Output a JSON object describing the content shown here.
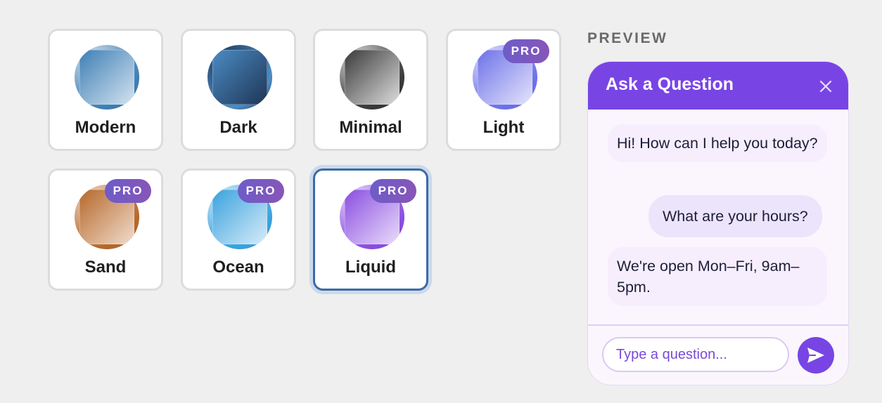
{
  "themes": [
    {
      "key": "modern",
      "label": "Modern",
      "pro": false,
      "selected": false,
      "colors": [
        "#3f7fb5",
        "#d3e3ef",
        "#2f6a9c"
      ]
    },
    {
      "key": "dark",
      "label": "Dark",
      "pro": false,
      "selected": false,
      "colors": [
        "#4b8cc4",
        "#1f3555",
        "#1a2a44"
      ]
    },
    {
      "key": "minimal",
      "label": "Minimal",
      "pro": false,
      "selected": false,
      "colors": [
        "#3a3a3a",
        "#dddddd",
        "#2a2a2a"
      ]
    },
    {
      "key": "light",
      "label": "Light",
      "pro": true,
      "selected": false,
      "colors": [
        "#6c72e8",
        "#e6e4fb",
        "#6a66df"
      ]
    },
    {
      "key": "sand",
      "label": "Sand",
      "pro": true,
      "selected": false,
      "colors": [
        "#b6682a",
        "#f0dccd",
        "#a25e2a"
      ]
    },
    {
      "key": "ocean",
      "label": "Ocean",
      "pro": true,
      "selected": false,
      "colors": [
        "#3aa2de",
        "#d8ecf8",
        "#3a8fd0"
      ]
    },
    {
      "key": "liquid",
      "label": "Liquid",
      "pro": true,
      "selected": true,
      "colors": [
        "#8a4ee0",
        "#eadcfb",
        "#7c47d8"
      ]
    }
  ],
  "pro_badge_label": "PRO",
  "preview": {
    "heading": "PREVIEW",
    "title": "Ask a Question",
    "messages": [
      {
        "role": "bot",
        "text": "Hi! How can I help you today?"
      },
      {
        "role": "user",
        "text": "What are your hours?"
      },
      {
        "role": "bot",
        "text": "We're open Mon–Fri, 9am–5pm."
      }
    ],
    "input_placeholder": "Type a question...",
    "input_value": "",
    "accent_color": "#7845e4",
    "close_icon": "close-icon",
    "send_icon": "send-icon"
  }
}
